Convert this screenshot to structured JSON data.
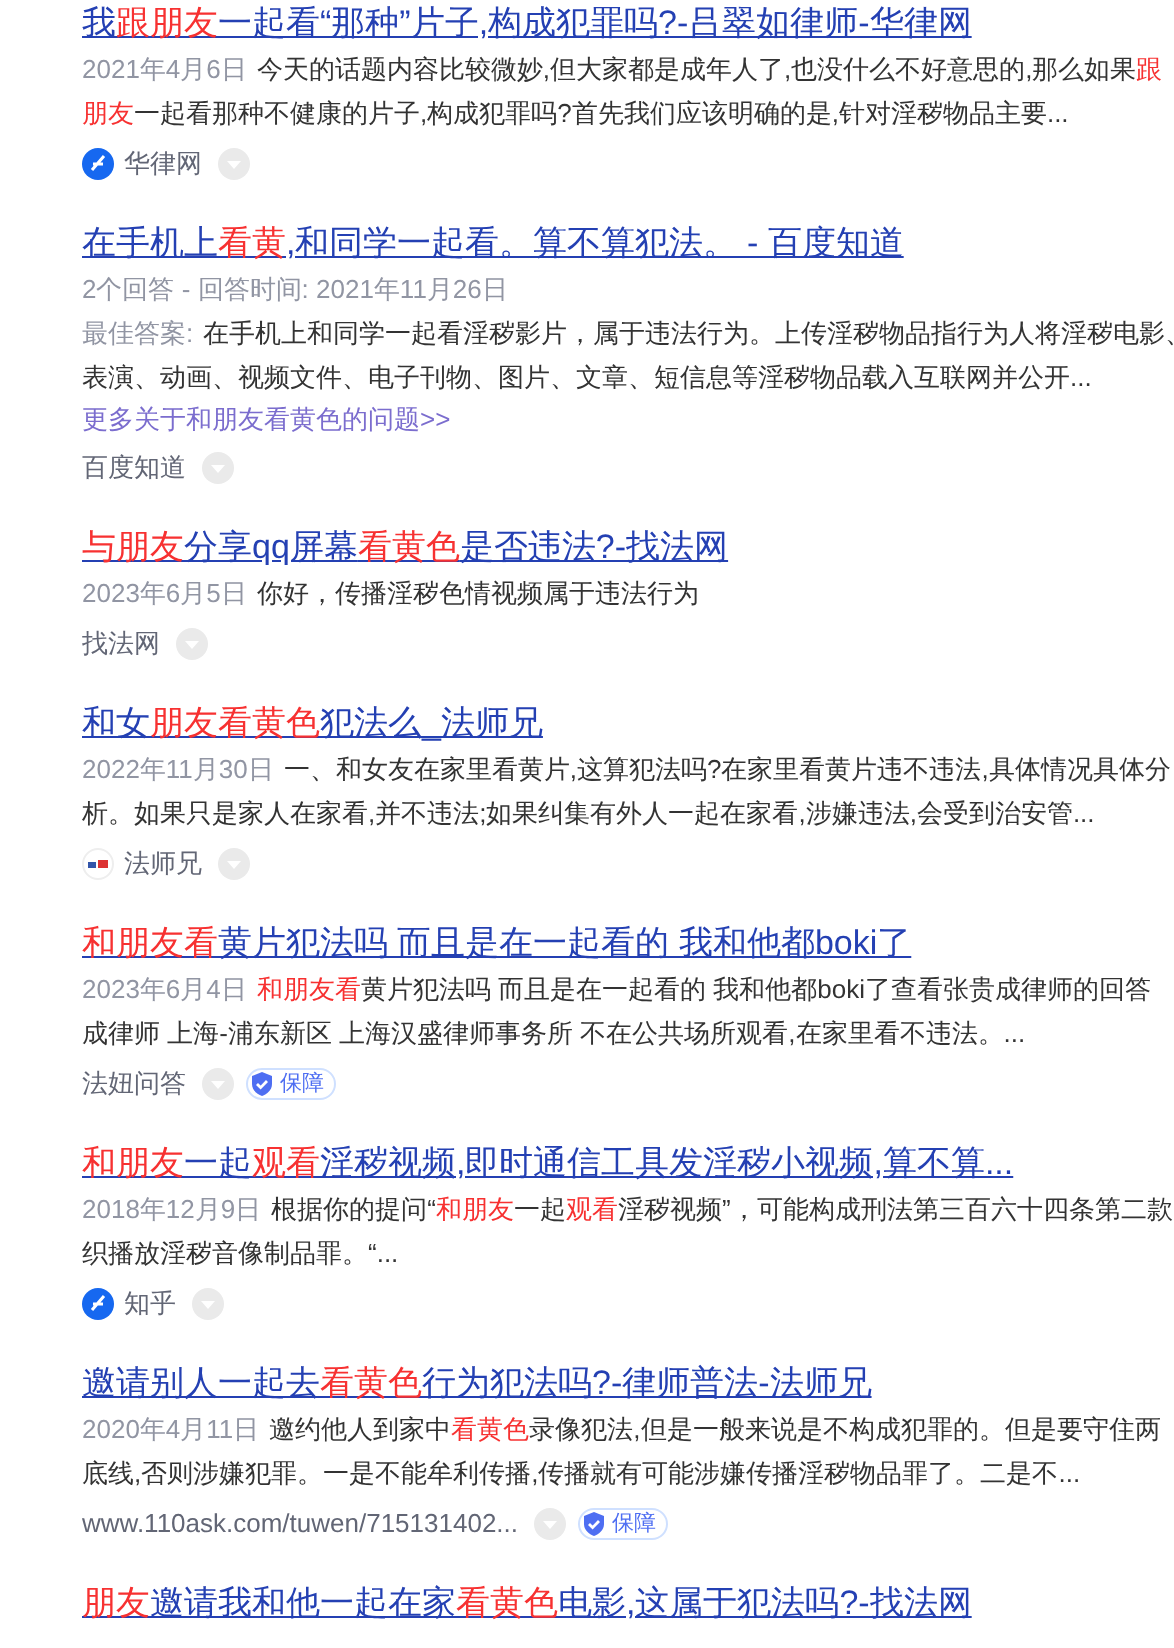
{
  "results": [
    {
      "title": [
        {
          "kind": "text",
          "text": "我"
        },
        {
          "kind": "highlight",
          "text": "跟朋友"
        },
        {
          "kind": "text",
          "text": "一起看“那种”片子,构成犯罪吗?-吕翠如律师-华律网"
        }
      ],
      "lines": [
        [
          {
            "kind": "date",
            "text": "2021年4月6日"
          },
          {
            "kind": "text",
            "text": "今天的话题内容比较微妙,但大家都是成年人了,也没什么不好意思的,那么如果"
          },
          {
            "kind": "highlight",
            "text": "跟"
          }
        ],
        [
          {
            "kind": "highlight",
            "text": "朋友"
          },
          {
            "kind": "text",
            "text": "一起看那种不健康的片子,构成犯罪吗?首先我们应该明确的是,针对淫秽物品主要..."
          }
        ]
      ],
      "source": {
        "kind": "round",
        "name": "华律网"
      }
    },
    {
      "title": [
        {
          "kind": "text",
          "text": "在手机上"
        },
        {
          "kind": "highlight",
          "text": "看黄"
        },
        {
          "kind": "text",
          "text": ",和同学一起看。算不算犯法。 - 百度知道"
        }
      ],
      "meta": "2个回答 - 回答时间: 2021年11月26日",
      "lines": [
        [
          {
            "kind": "date",
            "text": "最佳答案:"
          },
          {
            "kind": "text",
            "text": "在手机上和同学一起看淫秽影片，属于违法行为。上传淫秽物品指行为人将淫秽电影、"
          }
        ],
        [
          {
            "kind": "text",
            "text": "表演、动画、视频文件、电子刊物、图片、文章、短信息等淫秽物品载入互联网并公开..."
          }
        ]
      ],
      "more": "更多关于和朋友看黄色的问题>>",
      "source": {
        "name": "百度知道"
      }
    },
    {
      "title": [
        {
          "kind": "highlight",
          "text": "与朋友"
        },
        {
          "kind": "text",
          "text": "分享qq屏幕"
        },
        {
          "kind": "highlight",
          "text": "看黄色"
        },
        {
          "kind": "text",
          "text": "是否违法?-找法网"
        }
      ],
      "lines": [
        [
          {
            "kind": "date",
            "text": "2023年6月5日"
          },
          {
            "kind": "text",
            "text": "你好，传播淫秽色情视频属于违法行为"
          }
        ]
      ],
      "source": {
        "name": "找法网"
      }
    },
    {
      "title": [
        {
          "kind": "text",
          "text": "和女"
        },
        {
          "kind": "highlight",
          "text": "朋友看黄色"
        },
        {
          "kind": "text",
          "text": "犯法么_法师兄"
        }
      ],
      "lines": [
        [
          {
            "kind": "date",
            "text": "2022年11月30日"
          },
          {
            "kind": "text",
            "text": "一、和女友在家里看黄片,这算犯法吗?在家里看黄片违不违法,具体情况具体分"
          }
        ],
        [
          {
            "kind": "text",
            "text": "析。如果只是家人在家看,并不违法;如果纠集有外人一起在家看,涉嫌违法,会受到治安管..."
          }
        ]
      ],
      "source": {
        "kind": "mark",
        "name": "法师兄"
      }
    },
    {
      "title": [
        {
          "kind": "highlight",
          "text": "和朋友看"
        },
        {
          "kind": "text",
          "text": "黄片犯法吗 而且是在一起看的 我和他都boki了"
        }
      ],
      "lines": [
        [
          {
            "kind": "date",
            "text": "2023年6月4日"
          },
          {
            "kind": "highlight",
            "text": "和朋友看"
          },
          {
            "kind": "text",
            "text": "黄片犯法吗 而且是在一起看的 我和他都boki了查看张贵成律师的回答"
          }
        ],
        [
          {
            "kind": "text",
            "text": "成律师 上海-浦东新区 上海汉盛律师事务所 不在公共场所观看,在家里看不违法。..."
          }
        ]
      ],
      "source": {
        "name": "法妞问答",
        "guarantee": "保障"
      }
    },
    {
      "title": [
        {
          "kind": "highlight",
          "text": "和朋友"
        },
        {
          "kind": "text",
          "text": "一起"
        },
        {
          "kind": "highlight",
          "text": "观看"
        },
        {
          "kind": "text",
          "text": "淫秽视频,即时通信工具发淫秽小视频,算不算..."
        }
      ],
      "lines": [
        [
          {
            "kind": "date",
            "text": "2018年12月9日"
          },
          {
            "kind": "text",
            "text": "根据你的提问“"
          },
          {
            "kind": "highlight",
            "text": "和朋友"
          },
          {
            "kind": "text",
            "text": "一起"
          },
          {
            "kind": "highlight",
            "text": "观看"
          },
          {
            "kind": "text",
            "text": "淫秽视频”，可能构成刑法第三百六十四条第二款"
          }
        ],
        [
          {
            "kind": "text",
            "text": "织播放淫秽音像制品罪。“..."
          }
        ]
      ],
      "source": {
        "kind": "round",
        "name": "知乎"
      }
    },
    {
      "title": [
        {
          "kind": "text",
          "text": "邀请别人一起去"
        },
        {
          "kind": "highlight",
          "text": "看黄色"
        },
        {
          "kind": "text",
          "text": "行为犯法吗?-律师普法-法师兄"
        }
      ],
      "lines": [
        [
          {
            "kind": "date",
            "text": "2020年4月11日"
          },
          {
            "kind": "text",
            "text": "邀约他人到家中"
          },
          {
            "kind": "highlight",
            "text": "看黄色"
          },
          {
            "kind": "text",
            "text": "录像犯法,但是一般来说是不构成犯罪的。但是要守住两"
          }
        ],
        [
          {
            "kind": "text",
            "text": "底线,否则涉嫌犯罪。一是不能牟利传播,传播就有可能涉嫌传播淫秽物品罪了。二是不..."
          }
        ]
      ],
      "source": {
        "name": "www.110ask.com/tuwen/715131402...",
        "guarantee": "保障"
      }
    },
    {
      "title": [
        {
          "kind": "highlight",
          "text": "朋友"
        },
        {
          "kind": "text",
          "text": "邀请我和他一起在家"
        },
        {
          "kind": "highlight",
          "text": "看黄色"
        },
        {
          "kind": "text",
          "text": "电影,这属于犯法吗?-找法网"
        }
      ]
    }
  ]
}
